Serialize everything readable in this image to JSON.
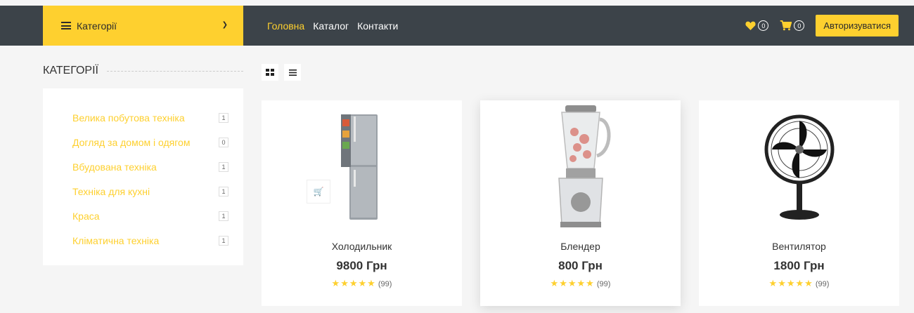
{
  "header": {
    "categories_label": "Категорії",
    "nav": [
      "Головна",
      "Каталог",
      "Контакти"
    ],
    "wishlist_count": "0",
    "cart_count": "0",
    "login_label": "Авторизуватися",
    "accent_color": "#fed02f",
    "bg_color": "#3c4349"
  },
  "sidebar": {
    "title": "КАТЕГОРІЇ",
    "items": [
      {
        "label": "Велика побутова техніка",
        "count": "1"
      },
      {
        "label": "Догляд за домом і одягом",
        "count": "0"
      },
      {
        "label": "Вбудована техніка",
        "count": "1"
      },
      {
        "label": "Техніка для кухні",
        "count": "1"
      },
      {
        "label": "Краса",
        "count": "1"
      },
      {
        "label": "Кліматична техніка",
        "count": "1"
      }
    ]
  },
  "products": [
    {
      "name": "Холодильник",
      "price": "9800 Грн",
      "stars": "★★★★★",
      "reviews": "(99)",
      "icon": "fridge-icon"
    },
    {
      "name": "Блендер",
      "price": "800 Грн",
      "stars": "★★★★★",
      "reviews": "(99)",
      "icon": "blender-icon"
    },
    {
      "name": "Вентилятор",
      "price": "1800 Грн",
      "stars": "★★★★★",
      "reviews": "(99)",
      "icon": "fan-icon"
    }
  ]
}
